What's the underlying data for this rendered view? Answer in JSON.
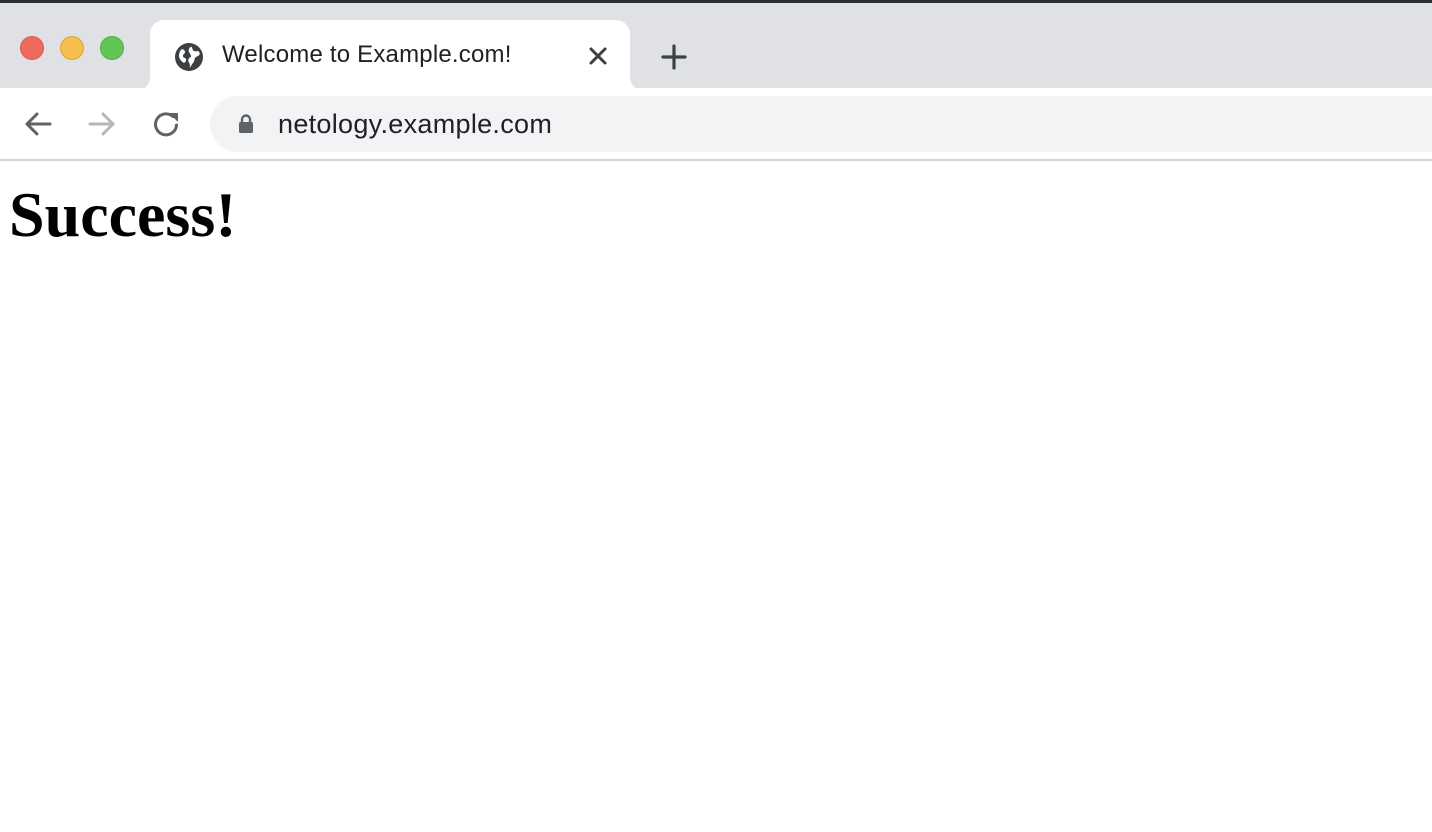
{
  "window": {
    "traffic_lights": {
      "close_color": "#ee6a5f",
      "minimize_color": "#f5be4f",
      "maximize_color": "#62c554"
    }
  },
  "tabs": [
    {
      "title": "Welcome to Example.com!",
      "favicon": "globe-icon",
      "active": true,
      "close_icon": "close-icon"
    }
  ],
  "new_tab": {
    "icon": "plus-icon"
  },
  "toolbar": {
    "back_icon": "arrow-left-icon",
    "forward_icon": "arrow-right-icon",
    "forward_enabled": false,
    "reload_icon": "reload-icon"
  },
  "omnibox": {
    "secure_icon": "lock-icon",
    "url": "netology.example.com"
  },
  "page": {
    "heading": "Success!"
  },
  "colors": {
    "tabstrip_bg": "#dfe1e5",
    "omnibox_bg": "#f1f3f4",
    "icon_dark": "#5f6368",
    "icon_disabled": "#b5b7ba",
    "text_primary": "#202124"
  }
}
